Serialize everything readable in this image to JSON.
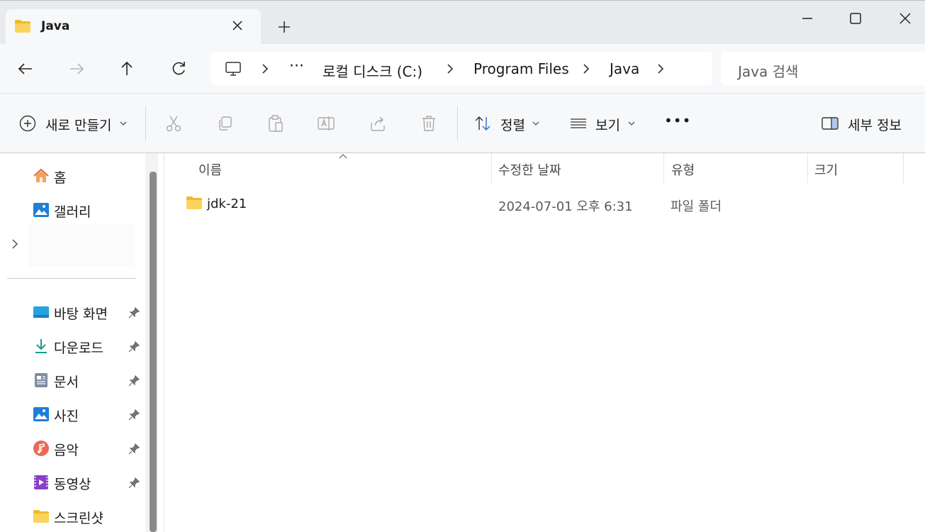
{
  "window": {
    "tab_title": "Java",
    "tab_icon": "folder-icon",
    "new_tab_symbol": "+",
    "controls": [
      "minimize-icon",
      "maximize-icon",
      "close-icon"
    ]
  },
  "navigation": {
    "back_icon": "arrow-left-icon",
    "forward_icon": "arrow-right-icon",
    "up_icon": "arrow-up-icon",
    "refresh_icon": "refresh-icon",
    "more": "···",
    "breadcrumb": [
      "로컬 디스크 (C:)",
      "Program Files",
      "Java"
    ],
    "search_placeholder": "Java 검색"
  },
  "commandbar": {
    "new_label": "새로 만들기",
    "sort_label": "정렬",
    "view_label": "보기",
    "more_label": "•••",
    "details_label": "세부 정보",
    "icons": [
      "cut-icon",
      "copy-icon",
      "paste-icon",
      "rename-icon",
      "share-icon",
      "delete-icon"
    ]
  },
  "sidebar": {
    "top_items": [
      {
        "label": "홈",
        "icon": "home-icon"
      },
      {
        "label": "갤러리",
        "icon": "gallery-icon"
      }
    ],
    "pinned_items": [
      {
        "label": "바탕 화면",
        "icon": "desktop-icon"
      },
      {
        "label": "다운로드",
        "icon": "download-icon"
      },
      {
        "label": "문서",
        "icon": "document-icon"
      },
      {
        "label": "사진",
        "icon": "pictures-icon"
      },
      {
        "label": "음악",
        "icon": "music-icon"
      },
      {
        "label": "동영상",
        "icon": "video-icon"
      },
      {
        "label": "스크린샷",
        "icon": "folder-icon"
      }
    ]
  },
  "file_list": {
    "columns": [
      "이름",
      "수정한 날짜",
      "유형",
      "크기"
    ],
    "sorted_column": "이름",
    "rows": [
      {
        "name": "jdk-21",
        "modified": "2024-07-01 오후 6:31",
        "type": "파일 폴더",
        "size": "",
        "icon": "folder-icon"
      }
    ]
  },
  "colors": {
    "titlebar_bg": "#e8eaee",
    "toolbar_bg": "#f7f8fa",
    "folder_yellow": "#f6c644",
    "accent_blue": "#1f6fd6"
  }
}
